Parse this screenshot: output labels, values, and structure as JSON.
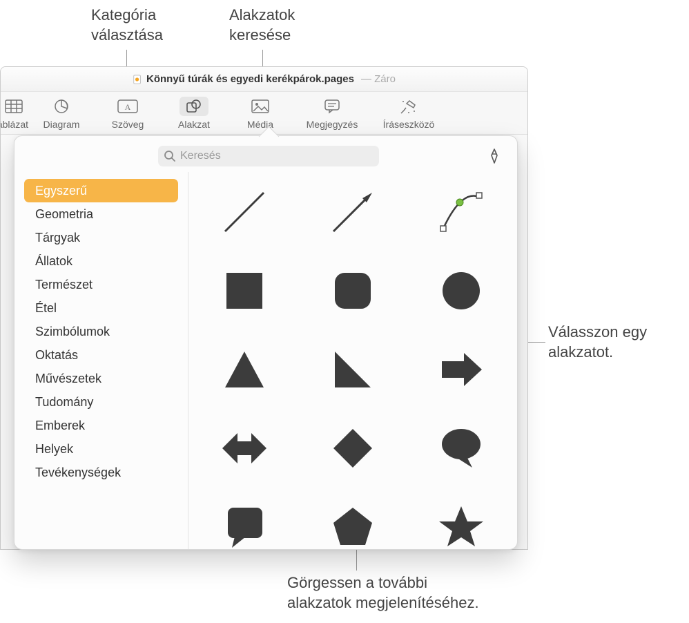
{
  "callouts": {
    "category": "Kategória\nválasztása",
    "search": "Alakzatok\nkeresése",
    "select": "Válasszon egy\nalakzatot.",
    "scroll": "Görgessen a további\nalakzatok megjelenítéséhez."
  },
  "window": {
    "title": "Könnyű túrák és egyedi kerékpárok.pages",
    "title_trailing": "— Záro"
  },
  "toolbar": {
    "table": "Táblázat",
    "chart": "Diagram",
    "text": "Szöveg",
    "shape": "Alakzat",
    "media": "Média",
    "comment": "Megjegyzés",
    "drawtools": "Íráseszközö"
  },
  "search": {
    "placeholder": "Keresés"
  },
  "categories": [
    {
      "label": "Egyszerű",
      "selected": true
    },
    {
      "label": "Geometria",
      "selected": false
    },
    {
      "label": "Tárgyak",
      "selected": false
    },
    {
      "label": "Állatok",
      "selected": false
    },
    {
      "label": "Természet",
      "selected": false
    },
    {
      "label": "Étel",
      "selected": false
    },
    {
      "label": "Szimbólumok",
      "selected": false
    },
    {
      "label": "Oktatás",
      "selected": false
    },
    {
      "label": "Művészetek",
      "selected": false
    },
    {
      "label": "Tudomány",
      "selected": false
    },
    {
      "label": "Emberek",
      "selected": false
    },
    {
      "label": "Helyek",
      "selected": false
    },
    {
      "label": "Tevékenységek",
      "selected": false
    }
  ],
  "shapes": [
    {
      "name": "line",
      "row": 0
    },
    {
      "name": "arrow-line",
      "row": 0
    },
    {
      "name": "bezier-curve",
      "row": 0
    },
    {
      "name": "square",
      "row": 1
    },
    {
      "name": "rounded-square",
      "row": 1
    },
    {
      "name": "circle",
      "row": 1
    },
    {
      "name": "triangle",
      "row": 2
    },
    {
      "name": "right-triangle",
      "row": 2
    },
    {
      "name": "arrow-right",
      "row": 2
    },
    {
      "name": "arrow-double",
      "row": 3
    },
    {
      "name": "diamond",
      "row": 3
    },
    {
      "name": "speech-bubble",
      "row": 3
    },
    {
      "name": "callout-square",
      "row": 4
    },
    {
      "name": "pentagon",
      "row": 4
    },
    {
      "name": "star",
      "row": 4
    }
  ]
}
